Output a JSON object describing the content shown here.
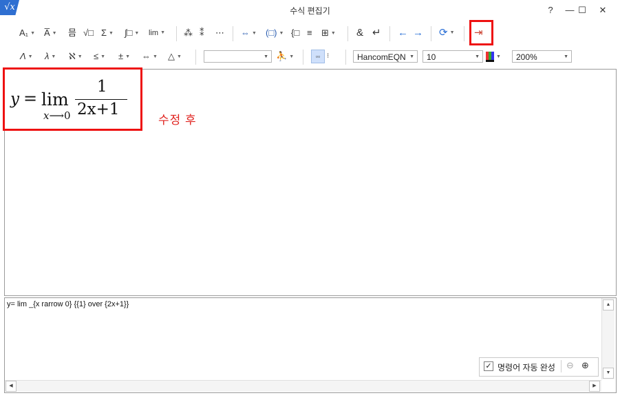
{
  "window": {
    "title": "수식 편집기",
    "logo": "√x",
    "help": "?",
    "minimize": "—",
    "maximize": "☐",
    "close": "✕"
  },
  "toolbar1": {
    "items": [
      {
        "name": "style-format-icon",
        "glyph": "A₁",
        "dd": true
      },
      {
        "name": "accent-icon",
        "glyph": "A̅",
        "dd": true
      },
      {
        "name": "fraction-icon",
        "glyph": "믐",
        "dd": false
      },
      {
        "name": "root-icon",
        "glyph": "√□",
        "dd": false
      },
      {
        "name": "sum-icon",
        "glyph": "Σ",
        "dd": true
      },
      {
        "name": "integral-icon",
        "glyph": "∫□",
        "dd": true
      },
      {
        "name": "limit-icon",
        "glyph": "lim",
        "dd": true
      },
      {
        "name": "matrix-a-icon",
        "glyph": "⁂",
        "dd": false
      },
      {
        "name": "matrix-b-icon",
        "glyph": "⁑",
        "dd": false
      },
      {
        "name": "matrix-c-icon",
        "glyph": "⋯",
        "dd": false
      },
      {
        "name": "brackets-icon",
        "glyph": "⇔",
        "dd": true
      },
      {
        "name": "parentheses-icon",
        "glyph": "(□)",
        "dd": true
      },
      {
        "name": "cases-icon",
        "glyph": "{□",
        "dd": false
      },
      {
        "name": "lines-icon",
        "glyph": "≡",
        "dd": false
      },
      {
        "name": "grid-icon",
        "glyph": "⊞",
        "dd": true
      },
      {
        "name": "ampersand-icon",
        "glyph": "&",
        "dd": false
      },
      {
        "name": "enter-icon",
        "glyph": "↵",
        "dd": false
      },
      {
        "name": "undo-arrow-icon",
        "glyph": "←",
        "dd": false
      },
      {
        "name": "redo-arrow-icon",
        "glyph": "→",
        "dd": false
      },
      {
        "name": "refresh-icon",
        "glyph": "⟳",
        "dd": true
      },
      {
        "name": "exit-icon",
        "glyph": "⇥",
        "dd": false
      }
    ]
  },
  "toolbar2": {
    "items": [
      {
        "name": "greek-upper-icon",
        "glyph": "Λ",
        "dd": true
      },
      {
        "name": "greek-lower-icon",
        "glyph": "λ",
        "dd": true
      },
      {
        "name": "hebrew-icon",
        "glyph": "ℵ",
        "dd": true
      },
      {
        "name": "relation-icon",
        "glyph": "≤",
        "dd": true
      },
      {
        "name": "operator-icon",
        "glyph": "±",
        "dd": true
      },
      {
        "name": "arrows-icon",
        "glyph": "⇔",
        "dd": true
      },
      {
        "name": "misc-symbol-icon",
        "glyph": "△",
        "dd": true
      }
    ],
    "style_combo": "",
    "font_combo": "HancomEQN",
    "size_combo": "10",
    "zoom_combo": "200%"
  },
  "equation": {
    "lhs": "y",
    "eq": "=",
    "op": "lim",
    "sub_var": "x",
    "sub_arrow": "⟶",
    "sub_val": "0",
    "numerator": "1",
    "denominator": "2x+1"
  },
  "note": "수정 후",
  "script": "y= lim _{x rarrow 0} {{1} over {2x+1}}",
  "autocomplete": {
    "label": "명령어 자동 완성",
    "checked": true
  },
  "colors": {
    "highlight": "#e11111",
    "note": "#e0231f"
  }
}
